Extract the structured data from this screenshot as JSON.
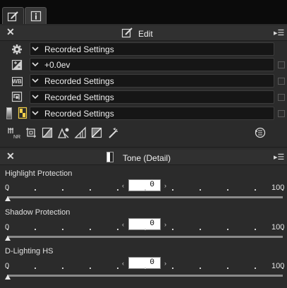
{
  "tabs": [
    {
      "icon": "edit-pencil-icon"
    },
    {
      "icon": "info-icon"
    }
  ],
  "edit_panel": {
    "title": "Edit",
    "rows": [
      {
        "icon": "gear-icon",
        "value": "Recorded Settings"
      },
      {
        "icon": "exposure-compensation-icon",
        "value": "+0.0ev"
      },
      {
        "icon": "white-balance-icon",
        "value": "Recorded Settings"
      },
      {
        "icon": "picture-control-icon",
        "value": "Recorded Settings"
      },
      {
        "icon": "active-d-lighting-icon",
        "value": "Recorded Settings"
      }
    ],
    "wb_badge": "WB"
  },
  "toolbar": {
    "nr_badge": "NR",
    "tools": [
      "noise-reduction-icon",
      "crop-icon",
      "tone-curve-icon",
      "color-booster-icon",
      "levels-icon",
      "color-balance-icon",
      "retouch-brush-icon",
      "history-icon"
    ]
  },
  "tone_panel": {
    "title": "Tone (Detail)",
    "sliders": [
      {
        "label": "Highlight Protection",
        "min": "0",
        "max": "100",
        "value": "0",
        "fraction": 0
      },
      {
        "label": "Shadow Protection",
        "min": "0",
        "max": "100",
        "value": "0",
        "fraction": 0
      },
      {
        "label": "D-Lighting HS",
        "min": "0",
        "max": "100",
        "value": "0",
        "fraction": 0
      }
    ]
  },
  "colors": {
    "accent": "#f2d04a",
    "panel_bg": "#2b2b2b",
    "field_bg": "#161616"
  }
}
